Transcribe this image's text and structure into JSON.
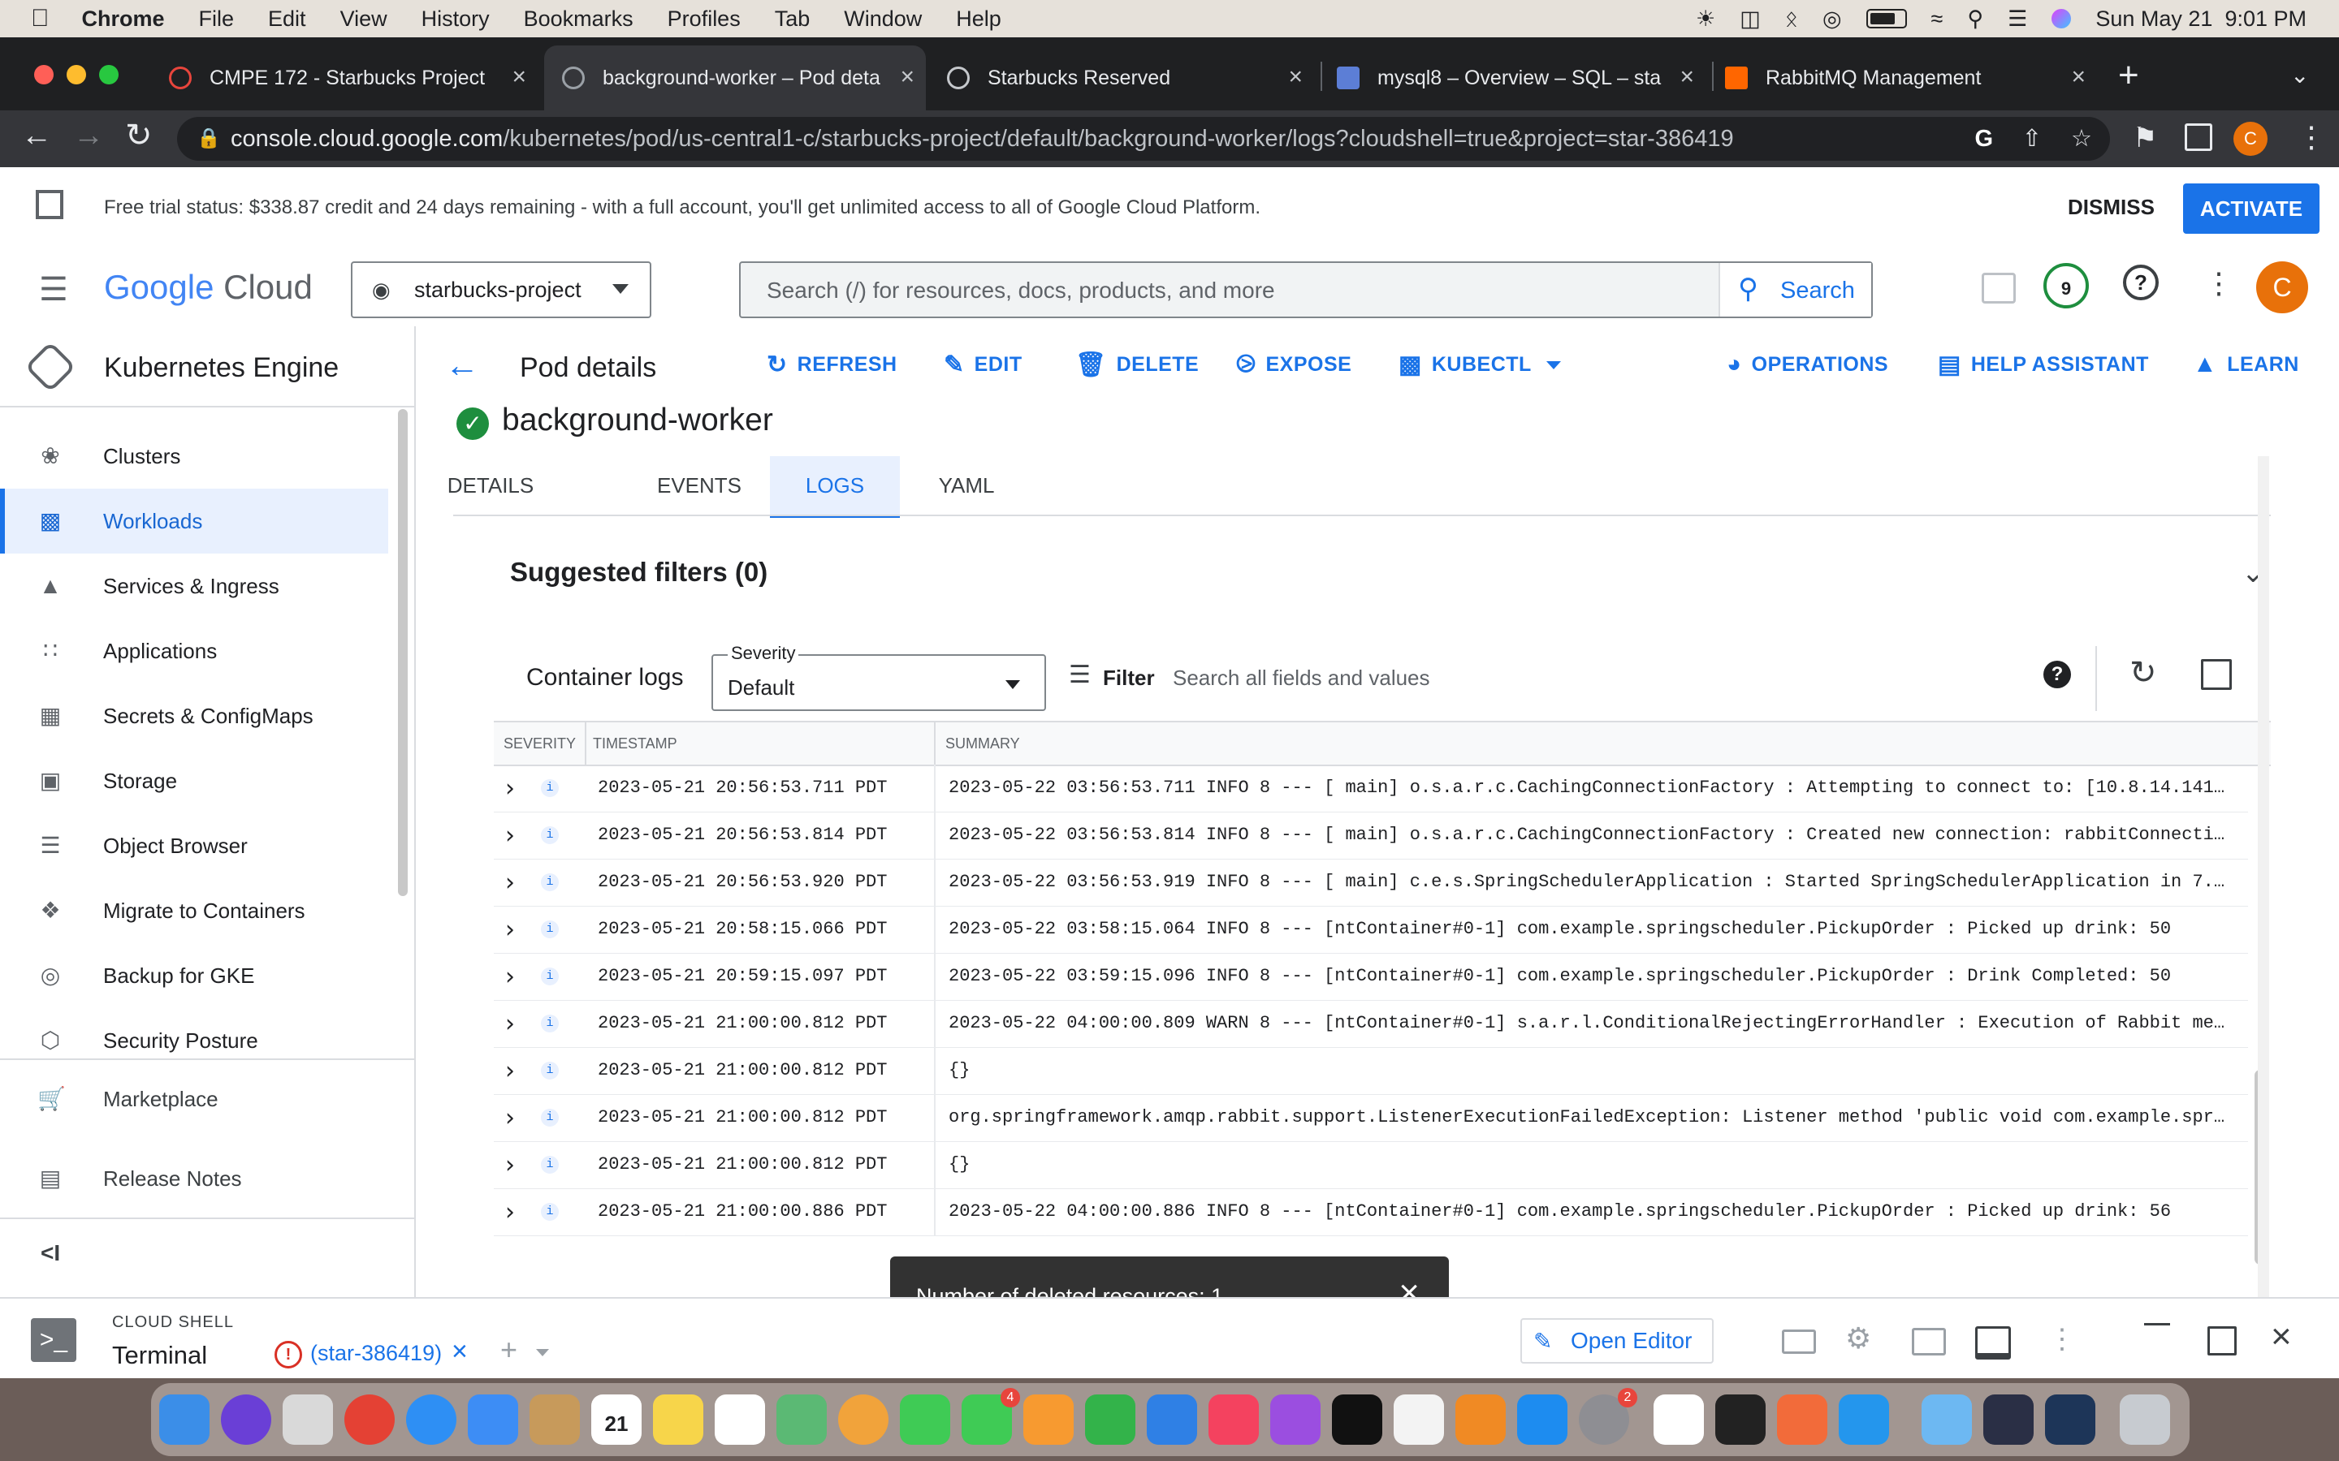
{
  "menubar": {
    "app": "Chrome",
    "items": [
      "File",
      "Edit",
      "View",
      "History",
      "Bookmarks",
      "Profiles",
      "Tab",
      "Window",
      "Help"
    ],
    "datetime": "Sun May 21  9:01 PM"
  },
  "tabs": [
    {
      "title": "CMPE 172 - Starbucks Project",
      "active": false
    },
    {
      "title": "background-worker – Pod deta",
      "active": true
    },
    {
      "title": "Starbucks Reserved",
      "active": false
    },
    {
      "title": "mysql8 – Overview – SQL – sta",
      "active": false
    },
    {
      "title": "RabbitMQ Management",
      "active": false
    }
  ],
  "url": {
    "host": "console.cloud.google.com",
    "path": "/kubernetes/pod/us-central1-c/starbucks-project/default/background-worker/logs?cloudshell=true&project=star-386419"
  },
  "profile_initial": "C",
  "trial": {
    "text": "Free trial status: $338.87 credit and 24 days remaining - with a full account, you'll get unlimited access to all of Google Cloud Platform.",
    "dismiss": "DISMISS",
    "activate": "ACTIVATE"
  },
  "header": {
    "logo_google": "Google",
    "logo_cloud": "Cloud",
    "project": "starbucks-project",
    "search_placeholder": "Search (/) for resources, docs, products, and more",
    "search_button": "Search",
    "notification_count": "9",
    "avatar": "C"
  },
  "sidebar": {
    "title": "Kubernetes Engine",
    "items": [
      {
        "label": "Clusters",
        "icon": "clusters-icon"
      },
      {
        "label": "Workloads",
        "icon": "workloads-icon",
        "selected": true
      },
      {
        "label": "Services & Ingress",
        "icon": "services-icon"
      },
      {
        "label": "Applications",
        "icon": "applications-icon"
      },
      {
        "label": "Secrets & ConfigMaps",
        "icon": "secrets-icon"
      },
      {
        "label": "Storage",
        "icon": "storage-icon"
      },
      {
        "label": "Object Browser",
        "icon": "object-browser-icon"
      },
      {
        "label": "Migrate to Containers",
        "icon": "migrate-icon"
      },
      {
        "label": "Backup for GKE",
        "icon": "backup-icon"
      },
      {
        "label": "Security Posture",
        "icon": "security-icon"
      }
    ],
    "marketplace": "Marketplace",
    "release_notes": "Release Notes"
  },
  "actionbar": {
    "title": "Pod details",
    "refresh": "REFRESH",
    "edit": "EDIT",
    "delete": "DELETE",
    "expose": "EXPOSE",
    "kubectl": "KUBECTL",
    "operations": "OPERATIONS",
    "help": "HELP ASSISTANT",
    "learn": "LEARN"
  },
  "pod": {
    "name": "background-worker",
    "tabs": [
      "DETAILS",
      "EVENTS",
      "LOGS",
      "YAML"
    ]
  },
  "filters": {
    "title": "Suggested filters (0)"
  },
  "logs_toolbar": {
    "container_logs": "Container logs",
    "severity_label": "Severity",
    "severity_value": "Default",
    "filter": "Filter",
    "search_placeholder": "Search all fields and values"
  },
  "log_columns": [
    "SEVERITY",
    "TIMESTAMP",
    "SUMMARY"
  ],
  "log_rows": [
    {
      "ts": "2023-05-21 20:56:53.711 PDT",
      "summary": "2023-05-22 03:56:53.711 INFO 8 --- [ main] o.s.a.r.c.CachingConnectionFactory : Attempting to connect to: [10.8.14.141…"
    },
    {
      "ts": "2023-05-21 20:56:53.814 PDT",
      "summary": "2023-05-22 03:56:53.814 INFO 8 --- [ main] o.s.a.r.c.CachingConnectionFactory : Created new connection: rabbitConnecti…"
    },
    {
      "ts": "2023-05-21 20:56:53.920 PDT",
      "summary": "2023-05-22 03:56:53.919 INFO 8 --- [ main] c.e.s.SpringSchedulerApplication : Started SpringSchedulerApplication in 7.…"
    },
    {
      "ts": "2023-05-21 20:58:15.066 PDT",
      "summary": "2023-05-22 03:58:15.064 INFO 8 --- [ntContainer#0-1] com.example.springscheduler.PickupOrder : Picked up drink: 50"
    },
    {
      "ts": "2023-05-21 20:59:15.097 PDT",
      "summary": "2023-05-22 03:59:15.096 INFO 8 --- [ntContainer#0-1] com.example.springscheduler.PickupOrder : Drink Completed: 50"
    },
    {
      "ts": "2023-05-21 21:00:00.812 PDT",
      "summary": "2023-05-22 04:00:00.809 WARN 8 --- [ntContainer#0-1] s.a.r.l.ConditionalRejectingErrorHandler : Execution of Rabbit me…"
    },
    {
      "ts": "2023-05-21 21:00:00.812 PDT",
      "summary": "{}"
    },
    {
      "ts": "2023-05-21 21:00:00.812 PDT",
      "summary": "org.springframework.amqp.rabbit.support.ListenerExecutionFailedException: Listener method 'public void com.example.spr…"
    },
    {
      "ts": "2023-05-21 21:00:00.812 PDT",
      "summary": "{}"
    },
    {
      "ts": "2023-05-21 21:00:00.886 PDT",
      "summary": "2023-05-22 04:00:00.886 INFO 8 --- [ntContainer#0-1] com.example.springscheduler.PickupOrder : Picked up drink: 56"
    }
  ],
  "toast": {
    "text": "Number of deleted resources: 1"
  },
  "shell": {
    "label": "CLOUD SHELL",
    "title": "Terminal",
    "tab": "(star-386419)",
    "open_editor": "Open Editor"
  },
  "dock_badges": {
    "facetime": "4",
    "system_settings": "2"
  },
  "colors": {
    "accent": "#1a73e8",
    "selected_bg": "#e8f0fe",
    "success": "#1e8e3e",
    "avatar": "#e8710a",
    "toast_bg": "#323232"
  }
}
